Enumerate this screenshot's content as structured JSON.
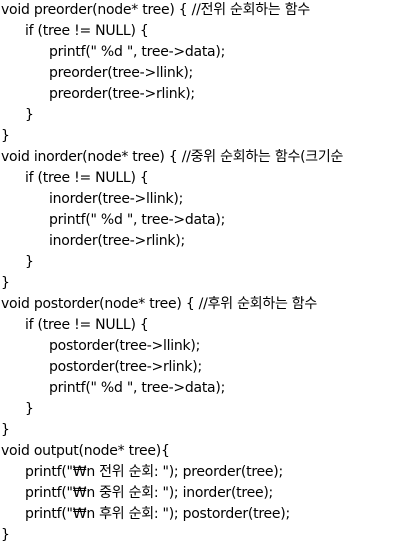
{
  "lines": [
    "void preorder(node* tree) { //전위 순회하는 함수",
    "if (tree != NULL) {",
    "printf(\" %d \", tree->data);",
    "preorder(tree->llink);",
    "preorder(tree->rlink);",
    "}",
    "}",
    "void inorder(node* tree) { //중위 순회하는 함수(크기순",
    "if (tree != NULL) {",
    "inorder(tree->llink);",
    "printf(\" %d \", tree->data);",
    "inorder(tree->rlink);",
    "}",
    "}",
    "void postorder(node* tree) { //후위 순회하는 함수",
    "if (tree != NULL) {",
    "postorder(tree->llink);",
    "postorder(tree->rlink);",
    "printf(\" %d \", tree->data);",
    "}",
    "}",
    "void output(node* tree){",
    "printf(\"₩n 전위 순회: \"); preorder(tree);",
    "printf(\"₩n 중위 순회: \"); inorder(tree);",
    "printf(\"₩n 후위 순회: \"); postorder(tree);",
    "}"
  ]
}
